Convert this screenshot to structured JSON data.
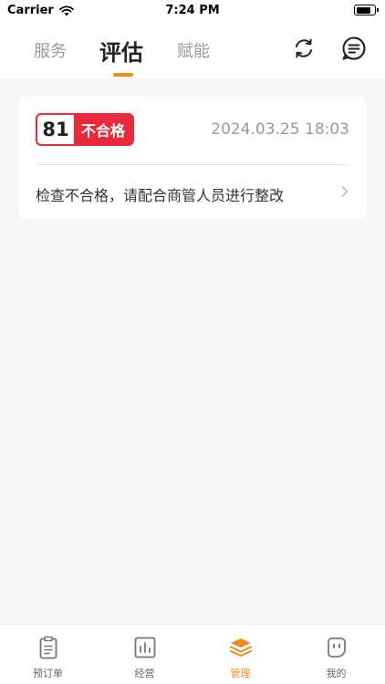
{
  "status_bar": {
    "carrier": "Carrier",
    "time": "7:24 PM",
    "battery_level": 0.85
  },
  "top_nav": {
    "tabs": [
      {
        "label": "服务",
        "active": false
      },
      {
        "label": "评估",
        "active": true
      },
      {
        "label": "赋能",
        "active": false
      }
    ],
    "icons": [
      "refresh-icon",
      "message-icon"
    ]
  },
  "assessment_card": {
    "score": "81",
    "result": "不合格",
    "datetime": "2024.03.25 18:03",
    "message": "检查不合格，请配合商管人员进行整改"
  },
  "bottom_bar": {
    "items": [
      {
        "label": "预订单",
        "icon": "clipboard-icon",
        "active": false
      },
      {
        "label": "经营",
        "icon": "chart-icon",
        "active": false
      },
      {
        "label": "管理",
        "icon": "layers-icon",
        "active": true
      },
      {
        "label": "我的",
        "icon": "face-icon",
        "active": false
      }
    ]
  },
  "colors": {
    "accent": "#f08a1c",
    "fail_red": "#ea2a3a",
    "background": "#f7f6f4"
  }
}
